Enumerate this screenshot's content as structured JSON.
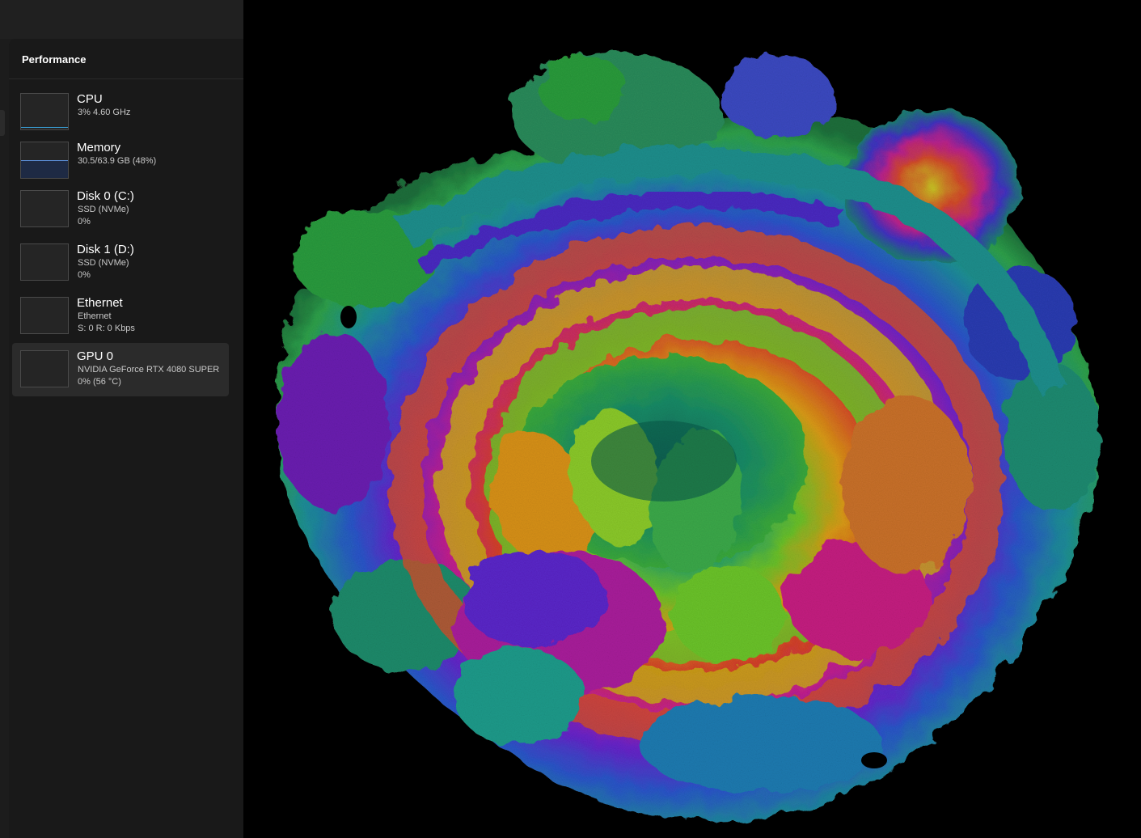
{
  "task_manager": {
    "page_title": "Performance",
    "items": [
      {
        "name": "CPU",
        "line1": "3%  4.60 GHz",
        "line2": "",
        "usage": 0.03,
        "color": "#3aa0d8",
        "selected": false
      },
      {
        "name": "Memory",
        "line1": "30.5/63.9 GB (48%)",
        "line2": "",
        "usage": 0.48,
        "color": "#5b8ed8",
        "selected": false
      },
      {
        "name": "Disk 0 (C:)",
        "line1": "SSD (NVMe)",
        "line2": "0%",
        "usage": 0.0,
        "color": "#5fbf5f",
        "selected": false
      },
      {
        "name": "Disk 1 (D:)",
        "line1": "SSD (NVMe)",
        "line2": "0%",
        "usage": 0.0,
        "color": "#5fbf5f",
        "selected": false
      },
      {
        "name": "Ethernet",
        "line1": "Ethernet",
        "line2": "S: 0  R: 0 Kbps",
        "usage": 0.0,
        "color": "#d08a3a",
        "selected": false
      },
      {
        "name": "GPU 0",
        "line1": "NVIDIA GeForce RTX 4080 SUPER",
        "line2": "0%  (56 °C)",
        "usage": 0.0,
        "color": "#2aa0a0",
        "selected": true
      }
    ]
  },
  "colors": {
    "background": "#000000",
    "sidebar": "#191919",
    "selected": "#2b2b2b"
  }
}
